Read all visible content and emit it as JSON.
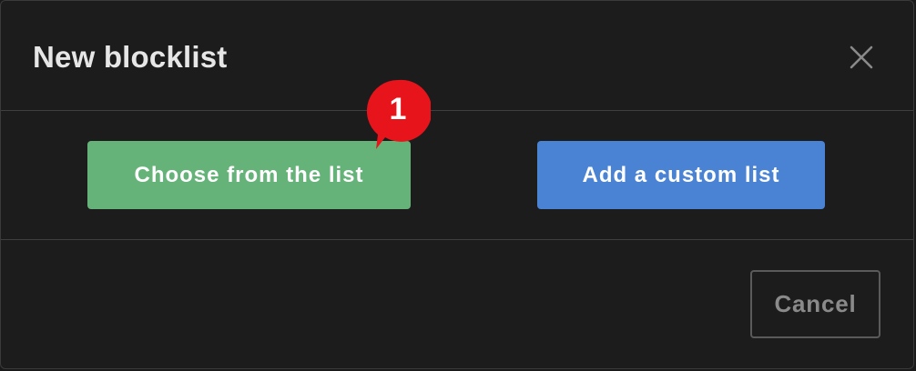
{
  "dialog": {
    "title": "New blocklist",
    "close_icon": "close-icon"
  },
  "actions": {
    "choose_label": "Choose from the list",
    "custom_label": "Add a custom list"
  },
  "badge": {
    "count": "1"
  },
  "footer": {
    "cancel_label": "Cancel"
  },
  "colors": {
    "background": "#1c1c1c",
    "choose_button": "#66b37a",
    "custom_button": "#4a83d4",
    "badge": "#e8141b"
  }
}
